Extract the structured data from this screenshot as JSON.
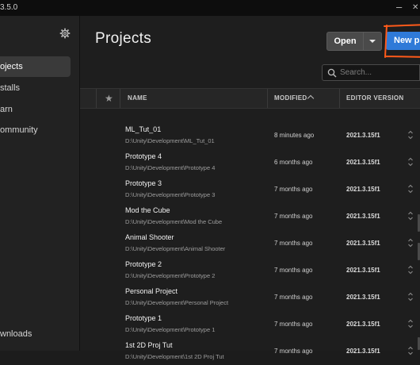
{
  "window": {
    "version": "3.5.0",
    "minimize": "–",
    "close": "✕"
  },
  "sidebar": {
    "items": [
      {
        "label": "Projects",
        "visible": "ojects",
        "active": true
      },
      {
        "label": "Installs",
        "visible": "stalls",
        "active": false
      },
      {
        "label": "Learn",
        "visible": "arn",
        "active": false
      },
      {
        "label": "Community",
        "visible": "ommunity",
        "active": false
      }
    ],
    "footer": "Downloads",
    "footer_visible": "wnloads",
    "icons": {
      "settings": "gear-icon"
    }
  },
  "header": {
    "title": "Projects",
    "open_label": "Open",
    "new_label": "New pro",
    "annotation_color": "#ff5a1a"
  },
  "search": {
    "placeholder": "Search..."
  },
  "table": {
    "columns": {
      "star": "★",
      "name": "NAME",
      "modified": "MODIFIED",
      "version": "EDITOR VERSION"
    },
    "rows": [
      {
        "name": "ML_Tut_01",
        "path": "D:\\Unity\\Development\\ML_Tut_01",
        "modified": "8 minutes ago",
        "version": "2021.3.15f1"
      },
      {
        "name": "Prototype 4",
        "path": "D:\\Unity\\Development\\Prototype 4",
        "modified": "6 months ago",
        "version": "2021.3.15f1"
      },
      {
        "name": "Prototype 3",
        "path": "D:\\Unity\\Development\\Prototype 3",
        "modified": "7 months ago",
        "version": "2021.3.15f1"
      },
      {
        "name": "Mod the Cube",
        "path": "D:\\Unity\\Development\\Mod the Cube",
        "modified": "7 months ago",
        "version": "2021.3.15f1"
      },
      {
        "name": "Animal Shooter",
        "path": "D:\\Unity\\Development\\Animal Shooter",
        "modified": "7 months ago",
        "version": "2021.3.15f1"
      },
      {
        "name": "Prototype 2",
        "path": "D:\\Unity\\Development\\Prototype 2",
        "modified": "7 months ago",
        "version": "2021.3.15f1"
      },
      {
        "name": "Personal Project",
        "path": "D:\\Unity\\Development\\Personal Project",
        "modified": "7 months ago",
        "version": "2021.3.15f1"
      },
      {
        "name": "Prototype 1",
        "path": "D:\\Unity\\Development\\Prototype 1",
        "modified": "7 months ago",
        "version": "2021.3.15f1"
      },
      {
        "name": "1st 2D Proj Tut",
        "path": "D:\\Unity\\Development\\1st 2D Proj Tut",
        "modified": "7 months ago",
        "version": "2021.3.15f1"
      }
    ]
  }
}
